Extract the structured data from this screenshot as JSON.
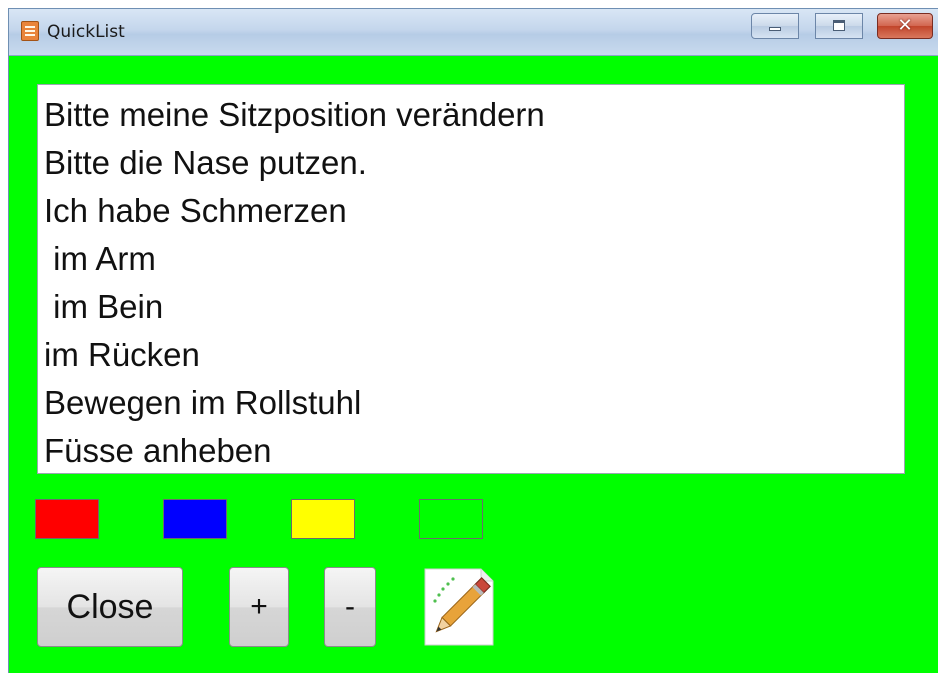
{
  "window": {
    "title": "QuickList",
    "background_color": "#00ff00",
    "controls": {
      "minimize_icon": "minimize-icon",
      "maximize_icon": "maximize-icon",
      "close_icon": "close-icon",
      "close_glyph": "✕"
    }
  },
  "list": {
    "items": [
      "Bitte meine Sitzposition verändern",
      "Bitte die Nase putzen.",
      "Ich habe Schmerzen",
      " im Arm",
      " im Bein",
      "im Rücken",
      "Bewegen im Rollstuhl",
      "Füsse anheben"
    ]
  },
  "color_swatches": [
    {
      "name": "red",
      "color": "#ff0000"
    },
    {
      "name": "blue",
      "color": "#0000ff"
    },
    {
      "name": "yellow",
      "color": "#ffff00"
    },
    {
      "name": "green",
      "color": "#00ff00"
    }
  ],
  "buttons": {
    "close_label": "Close",
    "plus_label": "+",
    "minus_label": "-",
    "edit_icon": "pencil-paper-icon"
  }
}
